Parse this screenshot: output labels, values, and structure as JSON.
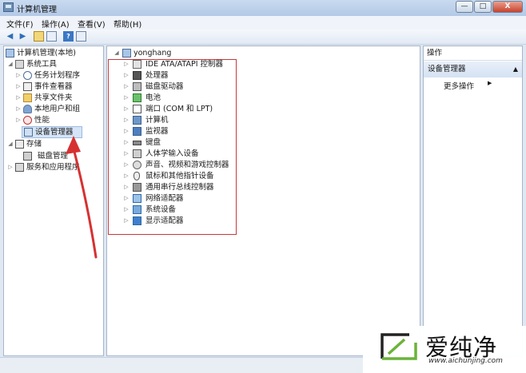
{
  "window": {
    "title": "计算机管理",
    "buttons": {
      "minimize": "—",
      "maximize": "□",
      "close": "X"
    }
  },
  "menubar": [
    "文件(F)",
    "操作(A)",
    "查看(V)",
    "帮助(H)"
  ],
  "toolbar": {
    "help_label": "?"
  },
  "left_tree": [
    {
      "label": "计算机管理(本地)",
      "icon": "computer-icon"
    },
    {
      "label": "系统工具",
      "icon": "tools-icon"
    },
    {
      "label": "任务计划程序",
      "icon": "clock-icon"
    },
    {
      "label": "事件查看器",
      "icon": "event-viewer-icon"
    },
    {
      "label": "共享文件夹",
      "icon": "folder-icon"
    },
    {
      "label": "本地用户和组",
      "icon": "users-icon"
    },
    {
      "label": "性能",
      "icon": "performance-icon"
    },
    {
      "label": "设备管理器",
      "icon": "device-manager-icon",
      "selected": true
    },
    {
      "label": "存储",
      "icon": "storage-icon"
    },
    {
      "label": "磁盘管理",
      "icon": "disk-icon"
    },
    {
      "label": "服务和应用程序",
      "icon": "services-icon"
    }
  ],
  "device_tree": {
    "root": "yonghang",
    "items": [
      {
        "label": "IDE ATA/ATAPI 控制器",
        "icon": "ide-icon"
      },
      {
        "label": "处理器",
        "icon": "processor-icon"
      },
      {
        "label": "磁盘驱动器",
        "icon": "disk-drive-icon"
      },
      {
        "label": "电池",
        "icon": "battery-icon"
      },
      {
        "label": "端口 (COM 和 LPT)",
        "icon": "port-icon"
      },
      {
        "label": "计算机",
        "icon": "computer-icon"
      },
      {
        "label": "监视器",
        "icon": "monitor-icon"
      },
      {
        "label": "键盘",
        "icon": "keyboard-icon"
      },
      {
        "label": "人体学输入设备",
        "icon": "hid-icon"
      },
      {
        "label": "声音、视频和游戏控制器",
        "icon": "sound-icon"
      },
      {
        "label": "鼠标和其他指针设备",
        "icon": "mouse-icon"
      },
      {
        "label": "通用串行总线控制器",
        "icon": "usb-icon"
      },
      {
        "label": "网络适配器",
        "icon": "network-icon"
      },
      {
        "label": "系统设备",
        "icon": "system-icon"
      },
      {
        "label": "显示适配器",
        "icon": "display-icon"
      }
    ]
  },
  "actions": {
    "header": "操作",
    "section": "设备管理器",
    "item": "更多操作"
  },
  "watermark": {
    "brand": "爱纯净",
    "url": "www.aichunjing.com"
  },
  "colors": {
    "highlight_box": "#c63a3a",
    "arrow": "#d63131",
    "selection": "#d5e4f6"
  }
}
